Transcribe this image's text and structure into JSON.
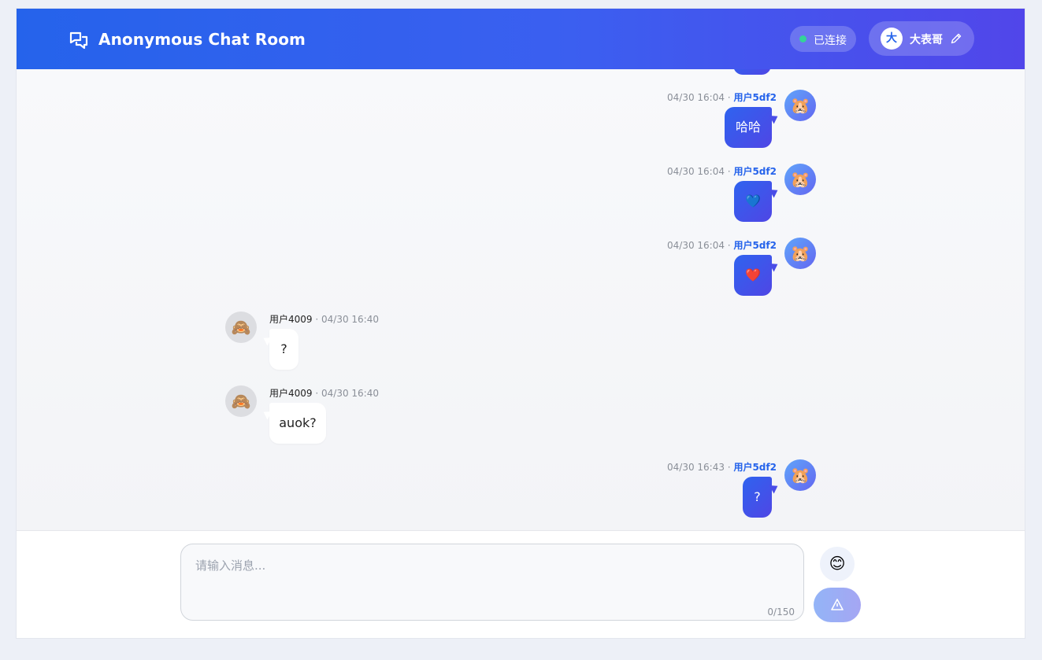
{
  "header": {
    "title": "Anonymous Chat Room",
    "logo_icon": "chat-bubbles-icon",
    "status": "已连接",
    "status_color": "#34d399",
    "user": {
      "avatar_char": "大",
      "name": "大表哥",
      "edit_icon": "pencil-icon"
    }
  },
  "messages": [
    {
      "side": "me",
      "time": "04/30 16:04",
      "sender": "用户5df2",
      "text": "哈哈",
      "avatar": "🐹"
    },
    {
      "side": "me",
      "time": "04/30 16:04",
      "sender": "用户5df2",
      "text": "💙",
      "avatar": "🐹"
    },
    {
      "side": "me",
      "time": "04/30 16:04",
      "sender": "用户5df2",
      "text": "❤️",
      "avatar": "🐹"
    },
    {
      "side": "other",
      "time": "04/30 16:40",
      "sender": "用户4009",
      "text": "?",
      "avatar": "🙈"
    },
    {
      "side": "other",
      "time": "04/30 16:40",
      "sender": "用户4009",
      "text": "auok?",
      "avatar": "🙈"
    },
    {
      "side": "me",
      "time": "04/30 16:43",
      "sender": "用户5df2",
      "text": "?",
      "avatar": "🐹"
    }
  ],
  "composer": {
    "placeholder": "请输入消息...",
    "counter": "0/150",
    "emoji_button": "😊",
    "send_icon": "send-icon"
  },
  "colors": {
    "header_start": "#2563eb",
    "header_end": "#5146ea",
    "accent": "#2563eb"
  }
}
